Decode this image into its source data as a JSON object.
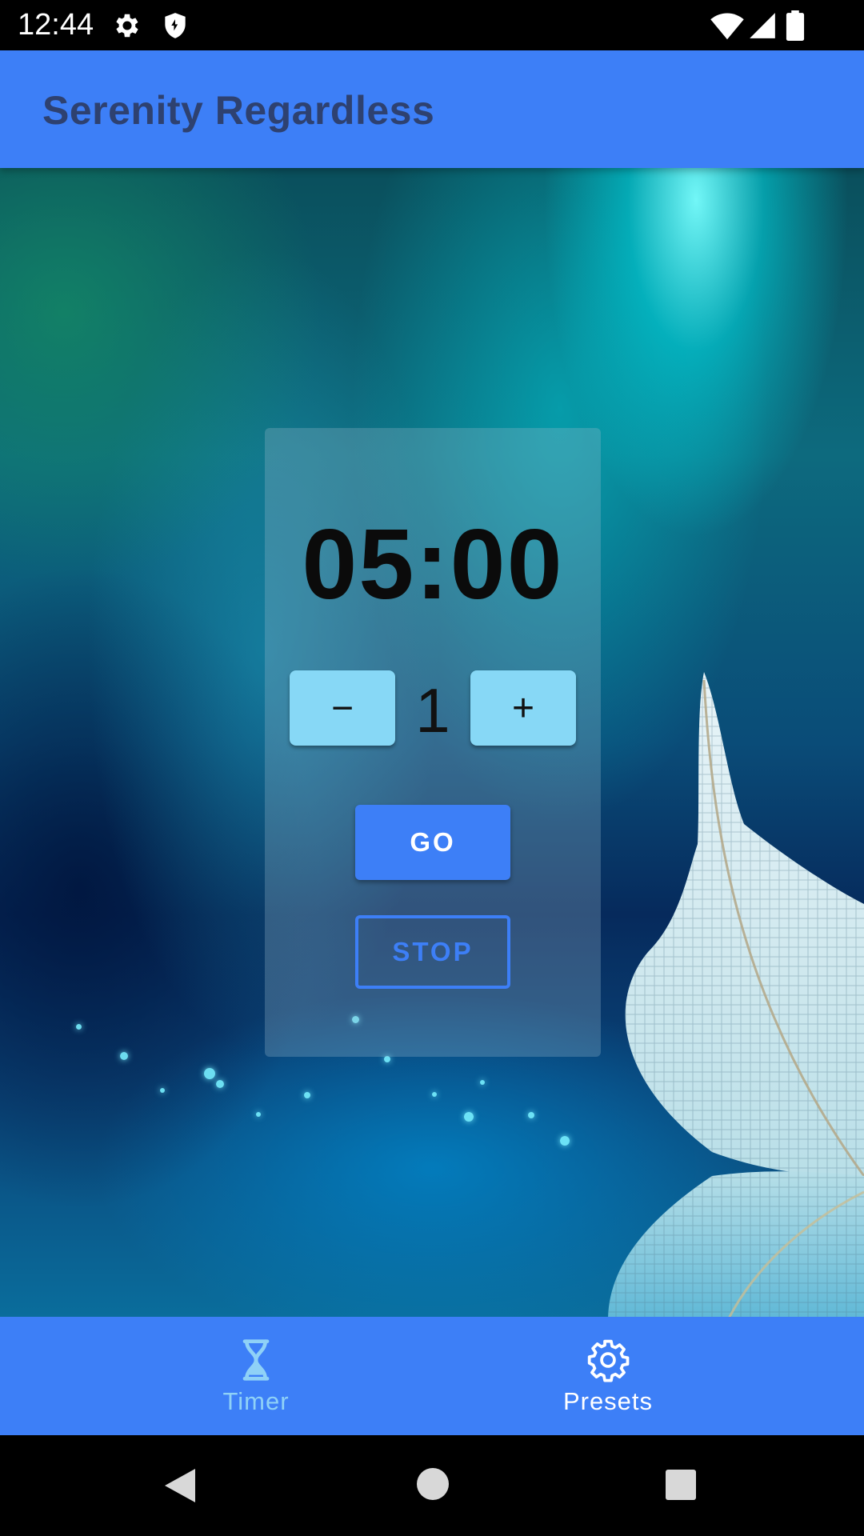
{
  "status_bar": {
    "time": "12:44",
    "icons": [
      "settings-icon",
      "shield-icon",
      "wifi-icon",
      "signal-icon",
      "battery-icon"
    ]
  },
  "app_bar": {
    "title": "Serenity Regardless"
  },
  "timer": {
    "display": "05:00",
    "stepper_value": "1",
    "decrement_label": "−",
    "increment_label": "+",
    "go_label": "GO",
    "stop_label": "STOP"
  },
  "bottom_nav": {
    "items": [
      {
        "label": "Timer",
        "icon": "hourglass-icon",
        "active": false
      },
      {
        "label": "Presets",
        "icon": "gear-icon",
        "active": true
      }
    ]
  },
  "system_nav": {
    "buttons": [
      "back-icon",
      "home-icon",
      "recents-icon"
    ]
  },
  "colors": {
    "primary": "#3d7ff7",
    "stepper": "#87d8f6",
    "title_text": "#2e4170",
    "inactive_nav": "#8fd1f7"
  }
}
